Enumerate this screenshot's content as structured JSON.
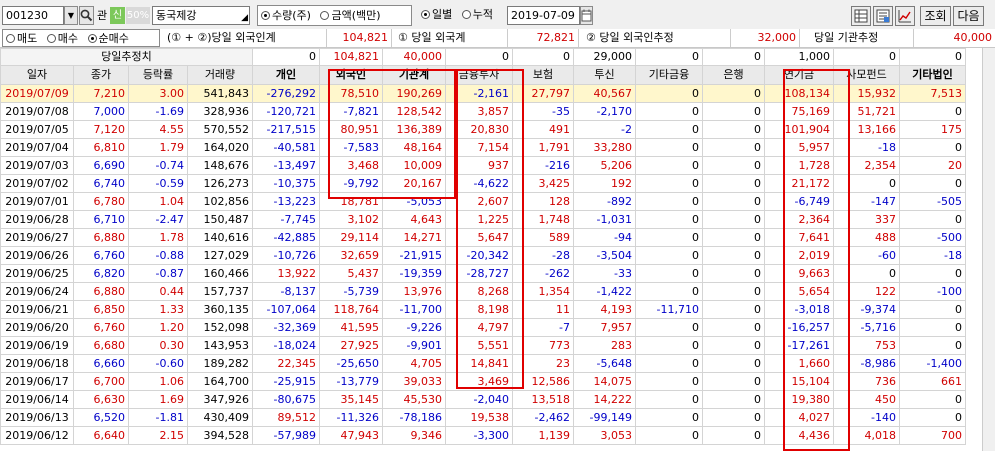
{
  "toolbar": {
    "code": "001230",
    "gwan_label": "관",
    "sin_label": "신",
    "pct_label": "50%",
    "name": "동국제강",
    "unit_options": [
      {
        "label": "수량(주)",
        "selected": true
      },
      {
        "label": "금액(백만)",
        "selected": false
      }
    ],
    "period_options": [
      {
        "label": "일별",
        "selected": true
      },
      {
        "label": "누적",
        "selected": false
      }
    ],
    "date": "2019-07-09",
    "lookup_label": "조회",
    "next_label": "다음"
  },
  "filter": {
    "trade_options": [
      {
        "label": "매도",
        "selected": false
      },
      {
        "label": "매수",
        "selected": false
      },
      {
        "label": "순매수",
        "selected": true
      }
    ],
    "formula_label": "(① + ②)당일 외국인계",
    "formula_value": "104,821",
    "f1_label": "① 당일 외국계",
    "f1_value": "72,821",
    "f2_label": "② 당일 외국인추정",
    "f2_value": "32,000",
    "inst_label": "당일 기관추정",
    "inst_value": "40,000"
  },
  "estimate_row": {
    "label": "당일추정치",
    "values": [
      "0",
      "104,821",
      "40,000",
      "0",
      "0",
      "29,000",
      "0",
      "0",
      "1,000",
      "0",
      "0"
    ]
  },
  "columns": [
    "일자",
    "종가",
    "등락률",
    "거래량",
    "개인",
    "외국인",
    "기관계",
    "금융투자",
    "보험",
    "투신",
    "기타금융",
    "은행",
    "연기금",
    "사모펀드",
    "기타법인"
  ],
  "rows": [
    [
      "2019/07/09",
      "7,210",
      "3.00",
      "541,843",
      "-276,292",
      "78,510",
      "190,269",
      "-2,161",
      "27,797",
      "40,567",
      "0",
      "0",
      "108,134",
      "15,932",
      "7,513"
    ],
    [
      "2019/07/08",
      "7,000",
      "-1.69",
      "328,936",
      "-120,721",
      "-7,821",
      "128,542",
      "3,857",
      "-35",
      "-2,170",
      "0",
      "0",
      "75,169",
      "51,721",
      "0"
    ],
    [
      "2019/07/05",
      "7,120",
      "4.55",
      "570,552",
      "-217,515",
      "80,951",
      "136,389",
      "20,830",
      "491",
      "-2",
      "0",
      "0",
      "101,904",
      "13,166",
      "175"
    ],
    [
      "2019/07/04",
      "6,810",
      "1.79",
      "164,020",
      "-40,581",
      "-7,583",
      "48,164",
      "7,154",
      "1,791",
      "33,280",
      "0",
      "0",
      "5,957",
      "-18",
      "0"
    ],
    [
      "2019/07/03",
      "6,690",
      "-0.74",
      "148,676",
      "-13,497",
      "3,468",
      "10,009",
      "937",
      "-216",
      "5,206",
      "0",
      "0",
      "1,728",
      "2,354",
      "20"
    ],
    [
      "2019/07/02",
      "6,740",
      "-0.59",
      "126,273",
      "-10,375",
      "-9,792",
      "20,167",
      "-4,622",
      "3,425",
      "192",
      "0",
      "0",
      "21,172",
      "0",
      "0"
    ],
    [
      "2019/07/01",
      "6,780",
      "1.04",
      "102,856",
      "-13,223",
      "18,781",
      "-5,053",
      "2,607",
      "128",
      "-892",
      "0",
      "0",
      "-6,749",
      "-147",
      "-505"
    ],
    [
      "2019/06/28",
      "6,710",
      "-2.47",
      "150,487",
      "-7,745",
      "3,102",
      "4,643",
      "1,225",
      "1,748",
      "-1,031",
      "0",
      "0",
      "2,364",
      "337",
      "0"
    ],
    [
      "2019/06/27",
      "6,880",
      "1.78",
      "140,616",
      "-42,885",
      "29,114",
      "14,271",
      "5,647",
      "589",
      "-94",
      "0",
      "0",
      "7,641",
      "488",
      "-500"
    ],
    [
      "2019/06/26",
      "6,760",
      "-0.88",
      "127,029",
      "-10,726",
      "32,659",
      "-21,915",
      "-20,342",
      "-28",
      "-3,504",
      "0",
      "0",
      "2,019",
      "-60",
      "-18"
    ],
    [
      "2019/06/25",
      "6,820",
      "-0.87",
      "160,466",
      "13,922",
      "5,437",
      "-19,359",
      "-28,727",
      "-262",
      "-33",
      "0",
      "0",
      "9,663",
      "0",
      "0"
    ],
    [
      "2019/06/24",
      "6,880",
      "0.44",
      "157,737",
      "-8,137",
      "-5,739",
      "13,976",
      "8,268",
      "1,354",
      "-1,422",
      "0",
      "0",
      "5,654",
      "122",
      "-100"
    ],
    [
      "2019/06/21",
      "6,850",
      "1.33",
      "360,135",
      "-107,064",
      "118,764",
      "-11,700",
      "8,198",
      "11",
      "4,193",
      "-11,710",
      "0",
      "-3,018",
      "-9,374",
      "0"
    ],
    [
      "2019/06/20",
      "6,760",
      "1.20",
      "152,098",
      "-32,369",
      "41,595",
      "-9,226",
      "4,797",
      "-7",
      "7,957",
      "0",
      "0",
      "-16,257",
      "-5,716",
      "0"
    ],
    [
      "2019/06/19",
      "6,680",
      "0.30",
      "143,953",
      "-18,024",
      "27,925",
      "-9,901",
      "5,551",
      "773",
      "283",
      "0",
      "0",
      "-17,261",
      "753",
      "0"
    ],
    [
      "2019/06/18",
      "6,660",
      "-0.60",
      "189,282",
      "22,345",
      "-25,650",
      "4,705",
      "14,841",
      "23",
      "-5,648",
      "0",
      "0",
      "1,660",
      "-8,986",
      "-1,400"
    ],
    [
      "2019/06/17",
      "6,700",
      "1.06",
      "164,700",
      "-25,915",
      "-13,779",
      "39,033",
      "3,469",
      "12,586",
      "14,075",
      "0",
      "0",
      "15,104",
      "736",
      "661"
    ],
    [
      "2019/06/14",
      "6,630",
      "1.69",
      "347,926",
      "-80,675",
      "35,145",
      "45,530",
      "-2,040",
      "13,518",
      "14,222",
      "0",
      "0",
      "19,380",
      "450",
      "0"
    ],
    [
      "2019/06/13",
      "6,520",
      "-1.81",
      "430,409",
      "89,512",
      "-11,326",
      "-78,186",
      "19,538",
      "-2,462",
      "-99,149",
      "0",
      "0",
      "4,027",
      "-140",
      "0"
    ],
    [
      "2019/06/12",
      "6,640",
      "2.15",
      "394,528",
      "-57,989",
      "47,943",
      "9,346",
      "-3,300",
      "1,139",
      "3,053",
      "0",
      "0",
      "4,436",
      "4,018",
      "700"
    ]
  ],
  "colors": {
    "up": "#d00000",
    "down": "#0000c8",
    "highlight_row": "#fff7cc",
    "emphasis_box": "#e00000"
  }
}
